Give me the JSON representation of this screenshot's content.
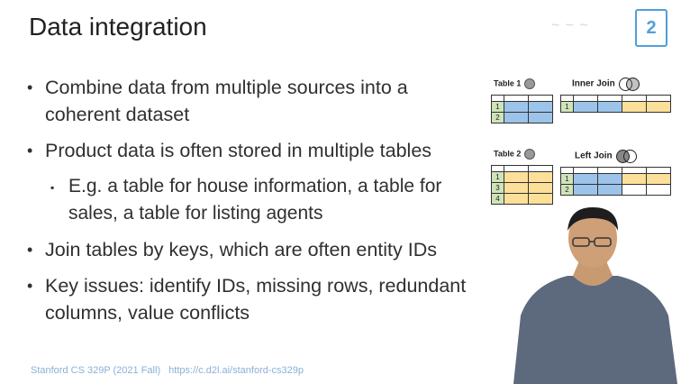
{
  "slide": {
    "title": "Data integration",
    "bullets": [
      "Combine data from multiple sources into a coherent dataset",
      "Product data is often stored in multiple tables",
      "E.g. a table for house information, a table for sales, a table for listing agents",
      "Join tables by keys, which are often entity IDs",
      "Key issues: identify IDs, missing rows, redundant columns, value conflicts"
    ],
    "footer_course": "Stanford CS 329P (2021 Fall)",
    "footer_link": "https://c.d2l.ai/stanford-cs329p"
  },
  "figure": {
    "table1_label": "Table 1",
    "table2_label": "Table 2",
    "inner_join_label": "Inner Join",
    "left_join_label": "Left Join",
    "table1_keys": [
      "1",
      "2"
    ],
    "table2_keys": [
      "1",
      "3",
      "4"
    ],
    "inner_keys": [
      "1"
    ],
    "left_keys": [
      "1",
      "2"
    ]
  },
  "colors": {
    "blue_cells": "#9cc4ea",
    "yellow_cells": "#fce09a",
    "key_cells": "#cfe4b8",
    "footer": "#8ab0d8"
  }
}
